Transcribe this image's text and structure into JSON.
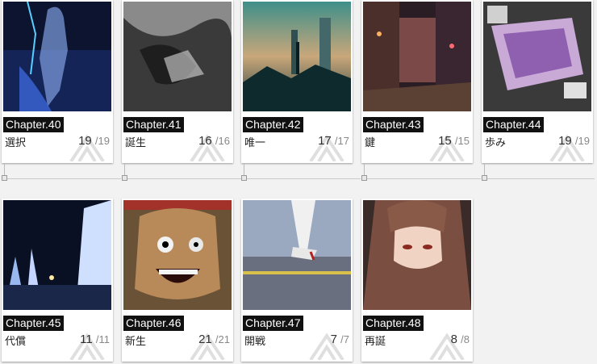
{
  "row1": [
    {
      "chapter": "Chapter.40",
      "name": "選択",
      "count": "19",
      "total": "/19",
      "thumb": "thumb-40"
    },
    {
      "chapter": "Chapter.41",
      "name": "誕生",
      "count": "16",
      "total": "/16",
      "thumb": "thumb-41"
    },
    {
      "chapter": "Chapter.42",
      "name": "唯一",
      "count": "17",
      "total": "/17",
      "thumb": "thumb-42"
    },
    {
      "chapter": "Chapter.43",
      "name": "鍵",
      "count": "15",
      "total": "/15",
      "thumb": "thumb-43"
    },
    {
      "chapter": "Chapter.44",
      "name": "歩み",
      "count": "19",
      "total": "/19",
      "thumb": "thumb-44"
    }
  ],
  "row2": [
    {
      "chapter": "Chapter.45",
      "name": "代償",
      "count": "11",
      "total": "/11",
      "thumb": "thumb-45"
    },
    {
      "chapter": "Chapter.46",
      "name": "新生",
      "count": "21",
      "total": "/21",
      "thumb": "thumb-46"
    },
    {
      "chapter": "Chapter.47",
      "name": "開戦",
      "count": "7",
      "total": "/7",
      "thumb": "thumb-47"
    },
    {
      "chapter": "Chapter.48",
      "name": "再誕",
      "count": "8",
      "total": "/8",
      "thumb": "thumb-48"
    }
  ],
  "colors": {
    "label_bg": "#111111",
    "page_bg": "#f2f2f2"
  }
}
